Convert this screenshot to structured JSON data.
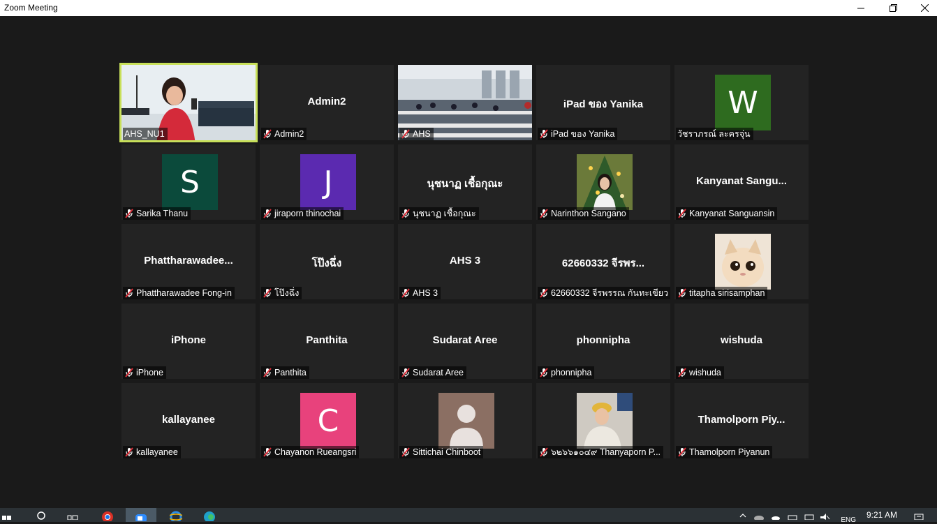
{
  "window": {
    "title": "Zoom Meeting"
  },
  "participants": [
    {
      "label": "AHS_NU1"
    },
    {
      "name": "Admin2",
      "label": "Admin2"
    },
    {
      "label": "AHS"
    },
    {
      "name": "iPad ของ Yanika",
      "label": "iPad ของ Yanika"
    },
    {
      "avatar": "W",
      "avatar_color": "#2e6b1f",
      "label": "วัชราภรณ์ ละครจุ่น"
    },
    {
      "avatar": "S",
      "avatar_color": "#0b4a3b",
      "label": "Sarika Thanu"
    },
    {
      "avatar": "J",
      "avatar_color": "#5b2ab0",
      "label": "jiraporn thinochai"
    },
    {
      "name": "นุชนาฏ เชื้อกุณะ",
      "label": "นุชนาฏ เชื้อกุณะ"
    },
    {
      "label": "Narinthon Sangano"
    },
    {
      "name": "Kanyanat  Sangu...",
      "label": "Kanyanat Sanguansin"
    },
    {
      "name": "Phattharawadee...",
      "label": "Phattharawadee Fong-in"
    },
    {
      "name": "โป๊งฉึ่ง",
      "label": "โป๊งฉึ่ง"
    },
    {
      "name": "AHS 3",
      "label": "AHS 3"
    },
    {
      "name": "62660332 จีรพร...",
      "label": "62660332 จีรพรรณ กันทะเขียว"
    },
    {
      "label": "titapha sirisamphan"
    },
    {
      "name": "iPhone",
      "label": "iPhone"
    },
    {
      "name": "Panthita",
      "label": "Panthita"
    },
    {
      "name": "Sudarat Aree",
      "label": "Sudarat Aree"
    },
    {
      "name": "phonnipha",
      "label": "phonnipha"
    },
    {
      "name": "wishuda",
      "label": "wishuda"
    },
    {
      "name": "kallayanee",
      "label": "kallayanee"
    },
    {
      "avatar": "C",
      "avatar_color": "#e8427c",
      "label": "Chayanon Rueangsri"
    },
    {
      "label": "Sittichai Chinboot"
    },
    {
      "label": "๖๒๖๖๑๐๔๙ Thanyaporn P..."
    },
    {
      "name": "Thamolporn  Piy...",
      "label": "Thamolporn Piyanun"
    }
  ],
  "taskbar": {
    "language": "ENG",
    "time": "9:21 AM"
  }
}
